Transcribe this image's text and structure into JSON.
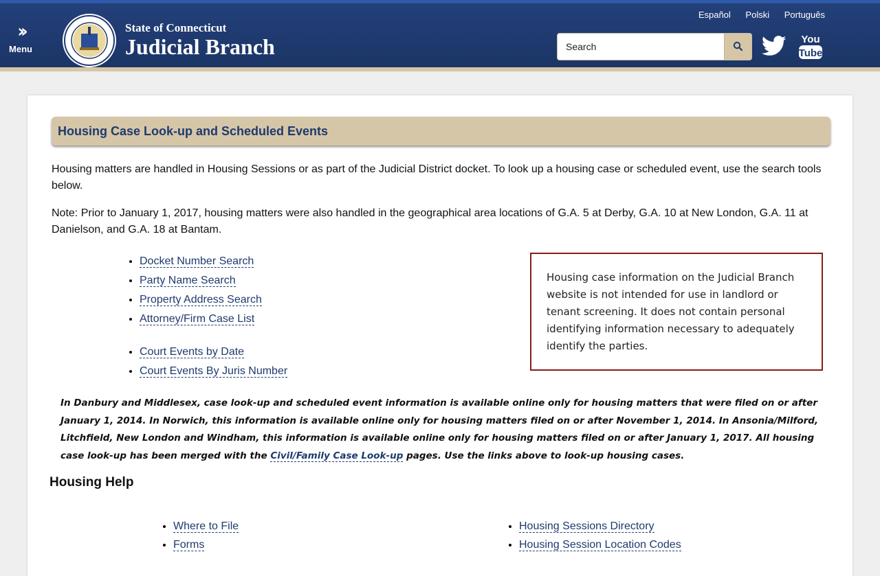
{
  "header": {
    "menu_label": "Menu",
    "brand_top": "State of Connecticut",
    "brand_main": "Judicial Branch",
    "languages": [
      "Español",
      "Polski",
      "Português"
    ],
    "search_placeholder": "Search",
    "icons": {
      "menu": "double-chevron-right-icon",
      "search": "magnifier-icon",
      "twitter": "twitter-icon",
      "youtube": "youtube-icon"
    },
    "colors": {
      "header_bg": "#1f3a70",
      "accent_tan": "#d6c6a6"
    }
  },
  "main": {
    "title": "Housing Case Look-up and Scheduled Events",
    "intro": "Housing matters are handled in Housing Sessions or as part of the Judicial District docket. To look up a housing case or scheduled event, use the search tools below.",
    "note": "Note: Prior to January 1, 2017, housing matters were also handled in the geographical area locations of G.A. 5 at Derby, G.A. 10 at New London, G.A. 11 at Danielson, and G.A. 18 at Bantam.",
    "lookup_links": [
      "Docket Number Search",
      "Party Name Search",
      "Property Address Search",
      "Attorney/Firm Case List"
    ],
    "event_links": [
      "Court Events by Date",
      "Court Events By Juris Number"
    ],
    "notice": "Housing case information on the Judicial Branch website is not intended for use in landlord or tenant screening. It does not contain personal identifying information necessary to adequately identify the parties.",
    "availability_before": "In Danbury and Middlesex, case look-up and scheduled event information is available online only for housing matters that were filed on or after January 1, 2014. In Norwich, this information is available online only for housing matters filed on or after November 1, 2014. In Ansonia/Milford, Litchfield, New London and Windham, this information is available online only for housing matters filed on or after January 1, 2017. All housing case look-up has been merged with the ",
    "availability_link": "Civil/Family Case Look-up",
    "availability_after": " pages. Use the links above to look-up housing cases.",
    "help_heading": "Housing Help",
    "help_left": [
      "Where to File",
      "Forms"
    ],
    "help_right": [
      "Housing Sessions Directory",
      "Housing Session Location Codes"
    ],
    "colors": {
      "title_bar": "#d6c6a8",
      "link": "#1e3a6e",
      "notice_border": "#8b1a1a"
    }
  }
}
